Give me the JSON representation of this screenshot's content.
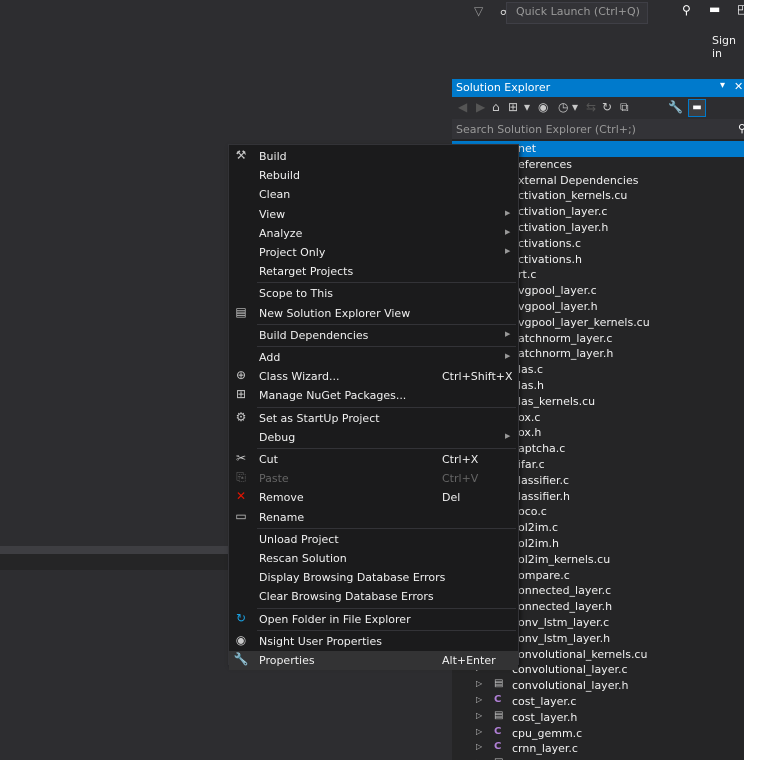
{
  "topbar": {
    "quick_launch_placeholder": "Quick Launch (Ctrl+Q)",
    "sign_in": "Sign in",
    "icons": [
      "filter-icon",
      "user-feedback-icon",
      "search-icon",
      "minimize-icon",
      "maximize-icon"
    ]
  },
  "solution_explorer": {
    "title": "Solution Explorer",
    "pin": "▾",
    "close": "✕",
    "search_placeholder": "Search Solution Explorer (Ctrl+;)",
    "tree": [
      {
        "label": "net",
        "selected": true,
        "icon": "",
        "expander": ""
      },
      {
        "label": "eferences",
        "icon": "",
        "expander": ""
      },
      {
        "label": "xternal Dependencies",
        "icon": "",
        "expander": ""
      },
      {
        "label": "ctivation_kernels.cu",
        "icon": "",
        "expander": ""
      },
      {
        "label": "ctivation_layer.c",
        "icon": "",
        "expander": ""
      },
      {
        "label": "ctivation_layer.h",
        "icon": "",
        "expander": ""
      },
      {
        "label": "ctivations.c",
        "icon": "",
        "expander": ""
      },
      {
        "label": "ctivations.h",
        "icon": "",
        "expander": ""
      },
      {
        "label": "rt.c",
        "icon": "",
        "expander": ""
      },
      {
        "label": "vgpool_layer.c",
        "icon": "",
        "expander": ""
      },
      {
        "label": "vgpool_layer.h",
        "icon": "",
        "expander": ""
      },
      {
        "label": "vgpool_layer_kernels.cu",
        "icon": "",
        "expander": ""
      },
      {
        "label": "atchnorm_layer.c",
        "icon": "",
        "expander": ""
      },
      {
        "label": "atchnorm_layer.h",
        "icon": "",
        "expander": ""
      },
      {
        "label": "las.c",
        "icon": "",
        "expander": ""
      },
      {
        "label": "las.h",
        "icon": "",
        "expander": ""
      },
      {
        "label": "las_kernels.cu",
        "icon": "",
        "expander": ""
      },
      {
        "label": "ox.c",
        "icon": "",
        "expander": ""
      },
      {
        "label": "ox.h",
        "icon": "",
        "expander": ""
      },
      {
        "label": "aptcha.c",
        "icon": "",
        "expander": ""
      },
      {
        "label": "ifar.c",
        "icon": "",
        "expander": ""
      },
      {
        "label": "lassifier.c",
        "icon": "",
        "expander": ""
      },
      {
        "label": "lassifier.h",
        "icon": "",
        "expander": ""
      },
      {
        "label": "oco.c",
        "icon": "",
        "expander": ""
      },
      {
        "label": "ol2im.c",
        "icon": "",
        "expander": ""
      },
      {
        "label": "ol2im.h",
        "icon": "",
        "expander": ""
      },
      {
        "label": "ol2im_kernels.cu",
        "icon": "",
        "expander": ""
      },
      {
        "label": "ompare.c",
        "icon": "",
        "expander": ""
      },
      {
        "label": "onnected_layer.c",
        "icon": "",
        "expander": ""
      },
      {
        "label": "onnected_layer.h",
        "icon": "",
        "expander": ""
      },
      {
        "label": "onv_lstm_layer.c",
        "icon": "",
        "expander": ""
      },
      {
        "label": "onv_lstm_layer.h",
        "icon": "",
        "expander": ""
      },
      {
        "label": "onvolutional_kernels.cu",
        "icon": "",
        "expander": ""
      },
      {
        "label": "convolutional_layer.c",
        "icon": "c",
        "expander": "▷"
      },
      {
        "label": "convolutional_layer.h",
        "icon": "h",
        "expander": "▷"
      },
      {
        "label": "cost_layer.c",
        "icon": "c",
        "expander": "▷"
      },
      {
        "label": "cost_layer.h",
        "icon": "h",
        "expander": "▷"
      },
      {
        "label": "cpu_gemm.c",
        "icon": "c",
        "expander": "▷"
      },
      {
        "label": "crnn_layer.c",
        "icon": "c",
        "expander": "▷"
      },
      {
        "label": "crnn_layer.h",
        "icon": "h",
        "expander": "▷"
      }
    ]
  },
  "context_menu": {
    "items": [
      {
        "type": "item",
        "label": "Build",
        "icon": "⚒",
        "icon_name": "build-icon"
      },
      {
        "type": "item",
        "label": "Rebuild"
      },
      {
        "type": "item",
        "label": "Clean"
      },
      {
        "type": "item",
        "label": "View",
        "submenu": true
      },
      {
        "type": "item",
        "label": "Analyze",
        "submenu": true
      },
      {
        "type": "item",
        "label": "Project Only",
        "submenu": true
      },
      {
        "type": "item",
        "label": "Retarget Projects"
      },
      {
        "type": "sep"
      },
      {
        "type": "item",
        "label": "Scope to This"
      },
      {
        "type": "item",
        "label": "New Solution Explorer View",
        "icon": "▤",
        "icon_name": "new-view-icon"
      },
      {
        "type": "sep"
      },
      {
        "type": "item",
        "label": "Build Dependencies",
        "submenu": true
      },
      {
        "type": "sep"
      },
      {
        "type": "item",
        "label": "Add",
        "submenu": true
      },
      {
        "type": "item",
        "label": "Class Wizard...",
        "icon": "⊕",
        "icon_name": "class-wizard-icon",
        "shortcut": "Ctrl+Shift+X"
      },
      {
        "type": "item",
        "label": "Manage NuGet Packages...",
        "icon": "⊞",
        "icon_name": "nuget-icon"
      },
      {
        "type": "sep"
      },
      {
        "type": "item",
        "label": "Set as StartUp Project",
        "icon": "⚙",
        "icon_name": "gear-icon"
      },
      {
        "type": "item",
        "label": "Debug",
        "submenu": true
      },
      {
        "type": "sep"
      },
      {
        "type": "item",
        "label": "Cut",
        "icon": "✂",
        "icon_name": "cut-icon",
        "shortcut": "Ctrl+X"
      },
      {
        "type": "item",
        "label": "Paste",
        "icon": "⎘",
        "icon_name": "paste-icon",
        "shortcut": "Ctrl+V",
        "disabled": true
      },
      {
        "type": "item",
        "label": "Remove",
        "icon": "✕",
        "icon_name": "remove-icon",
        "shortcut": "Del",
        "red": true
      },
      {
        "type": "item",
        "label": "Rename",
        "icon": "▭",
        "icon_name": "rename-icon"
      },
      {
        "type": "sep"
      },
      {
        "type": "item",
        "label": "Unload Project"
      },
      {
        "type": "item",
        "label": "Rescan Solution"
      },
      {
        "type": "item",
        "label": "Display Browsing Database Errors"
      },
      {
        "type": "item",
        "label": "Clear Browsing Database Errors"
      },
      {
        "type": "sep"
      },
      {
        "type": "item",
        "label": "Open Folder in File Explorer",
        "icon": "↻",
        "icon_name": "open-folder-icon",
        "blue": true
      },
      {
        "type": "sep"
      },
      {
        "type": "item",
        "label": "Nsight User Properties",
        "icon": "◉",
        "icon_name": "nsight-icon"
      },
      {
        "type": "item",
        "label": "Properties",
        "icon": "🔧",
        "icon_name": "wrench-icon",
        "shortcut": "Alt+Enter",
        "highlighted": true
      }
    ]
  }
}
